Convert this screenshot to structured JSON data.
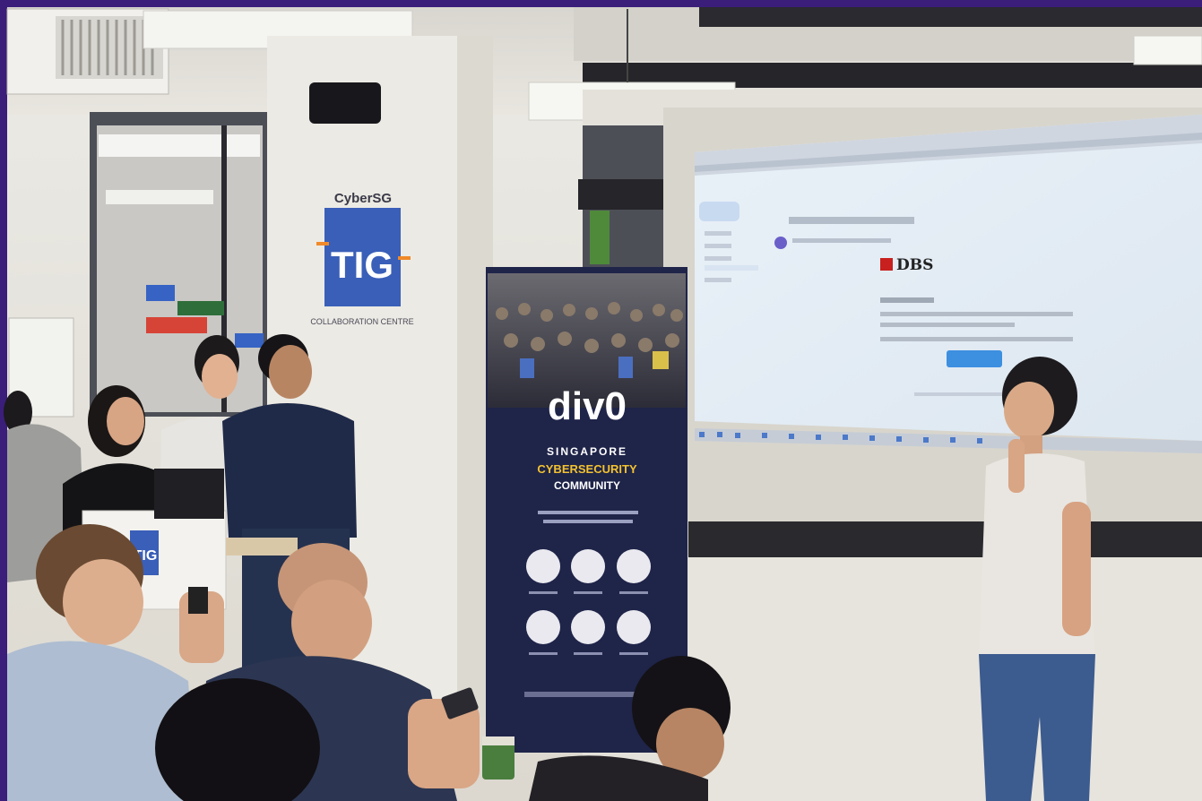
{
  "scene": {
    "description_text": {
      "partner_logo_top": "CyberSG",
      "partner_logo_mid": "TIG",
      "partner_logo_bottom": "COLLABORATION CENTRE",
      "podium_logo": "TIG"
    },
    "banner": {
      "brand": "div0",
      "line1": "SINGAPORE",
      "line2": "CYBERSECURITY",
      "line3": "COMMUNITY"
    },
    "screen": {
      "email_brand": "DBS"
    }
  },
  "colors": {
    "frame_purple": "#3b1e7a",
    "wall": "#e9e6df",
    "screen_bg": "#e6eef6",
    "banner_bg": "#1f2449",
    "banner_accent": "#f2c230",
    "tig_blue": "#3a5fb8",
    "dbs_red": "#c8201e",
    "button_blue": "#3d8fe0"
  }
}
